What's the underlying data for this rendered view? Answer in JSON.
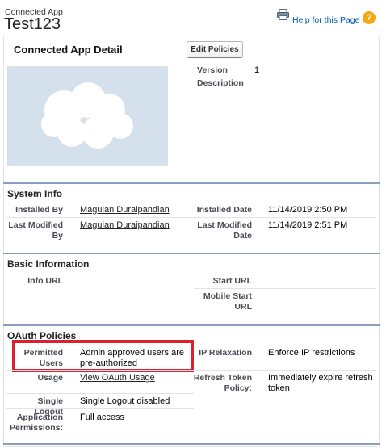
{
  "header": {
    "breadcrumb": "Connected App",
    "title": "Test123",
    "help_label": "Help for this Page",
    "printer_icon": "printer-icon",
    "help_icon": "help-icon"
  },
  "detail": {
    "title": "Connected App Detail",
    "edit_button": "Edit Policies",
    "fields": [
      {
        "label": "Version",
        "value": "1"
      },
      {
        "label": "Description",
        "value": ""
      }
    ],
    "logo_icon": "cloud-icon"
  },
  "system_info": {
    "title": "System Info",
    "installed_by_label": "Installed By",
    "installed_by_value": "Magulan Duraipandian",
    "installed_date_label": "Installed Date",
    "installed_date_value": "11/14/2019 2:50 PM",
    "modified_by_label_1": "Last Modified",
    "modified_by_label_2": "By",
    "modified_by_value": "Magulan Duraipandian",
    "modified_date_label_1": "Last Modified",
    "modified_date_label_2": "Date",
    "modified_date_value": "11/14/2019 2:51 PM"
  },
  "basic_info": {
    "title": "Basic Information",
    "info_url_label": "Info URL",
    "start_url_label": "Start URL",
    "mobile_label_1": "Mobile Start",
    "mobile_label_2": "URL"
  },
  "oauth": {
    "title": "OAuth Policies",
    "permitted_label_1": "Permitted",
    "permitted_label_2": "Users",
    "permitted_value_1": "Admin approved users are",
    "permitted_value_2": "pre-authorized",
    "ip_label": "IP Relaxation",
    "ip_value": "Enforce IP restrictions",
    "usage_label": "Usage",
    "usage_value": "View OAuth Usage",
    "refresh_label_1": "Refresh Token",
    "refresh_label_2": "Policy:",
    "refresh_value_1": "Immediately expire refresh",
    "refresh_value_2": "token",
    "logout_label": "Single Logout",
    "logout_value": "Single Logout disabled",
    "perm_label_1": "Application",
    "perm_label_2": "Permissions:",
    "perm_value": "Full access"
  },
  "colors": {
    "highlight": "#d9212f",
    "section_rule": "#8a9ebe",
    "link": "#015ba7",
    "help_icon": "#f5a614"
  }
}
